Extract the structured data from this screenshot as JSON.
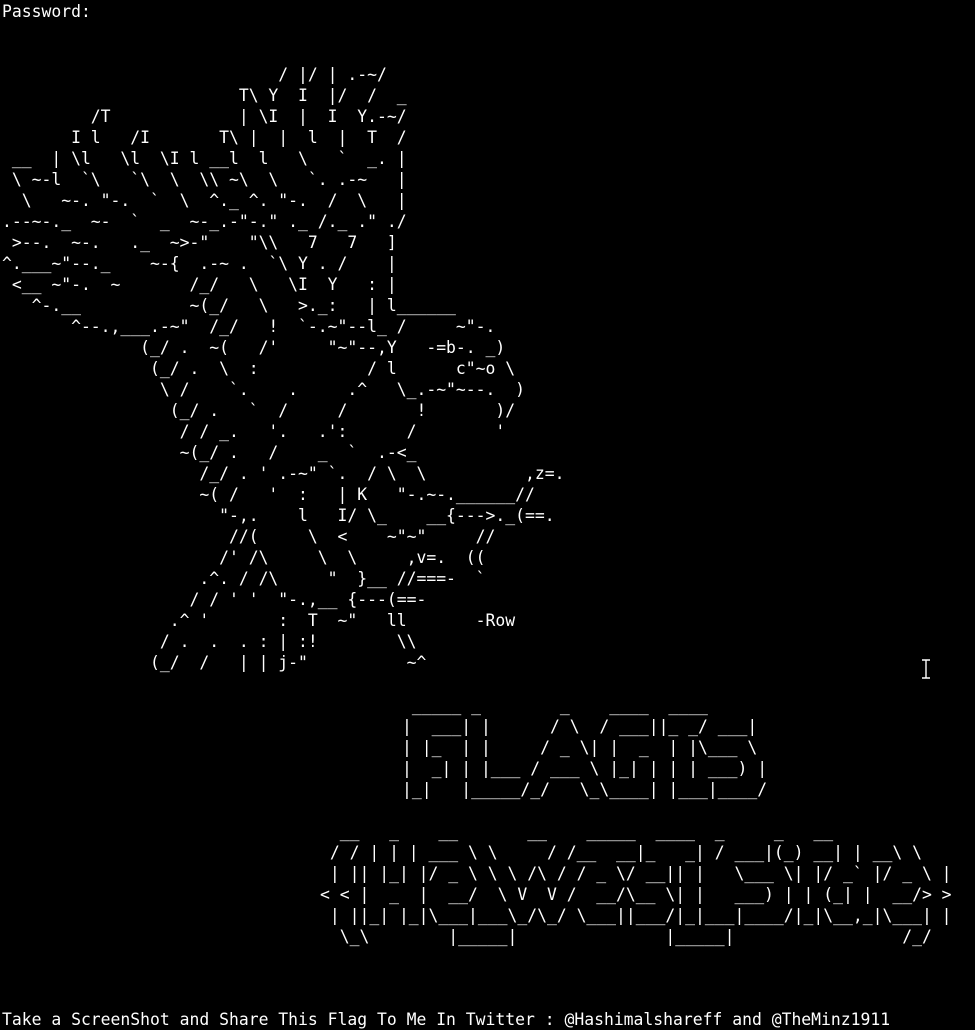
{
  "terminal": {
    "background": "#000000",
    "foreground": "#ffffff",
    "prompt": "Password:",
    "eagle_art": "                            / |/ | .-~/\n                        T\\ Y  I  |/  /  _\n         /T             | \\I  |  I  Y.-~/\n       I l   /I       T\\ |  |  l  |  T  /\n __  | \\l   \\l  \\I l __l  l   \\   `  _. |\n \\ ~-l  `\\   `\\  \\  \\\\ ~\\  \\   `. .-~   |\n  \\   ~-. \"-.  `  \\  ^._ ^. \"-.  /  \\   |\n.--~-._  ~-  `  _  ~-_.-\"-.\" ._ /._ .\" ./\n >--.  ~-.   ._  ~>-\"    \"\\\\   7   7   ]\n^.___~\"--._    ~-{  .-~ .  `\\ Y . /    |\n <__ ~\"-.  ~       /_/   \\   \\I  Y   : |\n   ^-.__           ~(_/   \\   >._:   | l______\n       ^--.,___.-~\"  /_/   !  `-.~\"--l_ /     ~\"-.\n              (_/ .  ~(   /'     \"~\"--,Y   -=b-. _)\n               (_/ .  \\  :           / l      c\"~o \\\n                \\ /    `.    .     .^   \\_.-~\"~--.  )\n                 (_/ .   `  /     /       !       )/\n                  / / _.   '.   .':      /        '\n                  ~(_/ .   /    _  `  .-<_\n                    /_/ . ' .-~\" `.  / \\  \\          ,z=.\n                    ~( /   '  :   | K   \"-.~-.______//\n                      \"-,.    l   I/ \\_    __{--->._(==.\n                       //(     \\  <    ~\"~\"     //\n                      /' /\\     \\  \\     ,v=.  ((\n                    .^. / /\\     \"  }__ //===-  `\n                   / / ' '  \"-.,__ {---(==-\n                 .^ '       :  T  ~\"   ll       -Row\n                / .  .  . : | :!        \\\\\n               (_/  /   | | j-\"          ~^",
    "flags_banner": " _____ _        _    ____  ____\n|  ___| |      / \\  / ___||_ _/ ___|\n| |_  | |     / _ \\| |  _  | |\\___ \\\n|  _| | |___ / ___ \\ |_| | | | ___) |\n|_|   |_____/_/   \\_\\____| |___|____/",
    "welcome_banner": "  __   _    __       __    _____  ____  _     _   __\n / / | | | ___ \\ \\     / /__  __|_   _| / ___|(_) __| | __\\ \\\n | || |_| |/ _ \\ \\ \\ /\\ / / _ \\/ __|| |   \\___ \\| |/ _` |/ _ \\ |\n< < |  _  |  __/  \\ V  V /  __/\\__ \\| |   ___) | | (_| |  __/> >\n | ||_| |_|\\___|___\\_/\\_/ \\___||___/|_|___|____/|_|\\__,_|\\___| |\n  \\_\\        |_____|               |_____|                 /_/",
    "footer_message": "Take a ScreenShot and Share This Flag To Me In Twitter : @Hashimalshareff and @TheMinz1911"
  }
}
